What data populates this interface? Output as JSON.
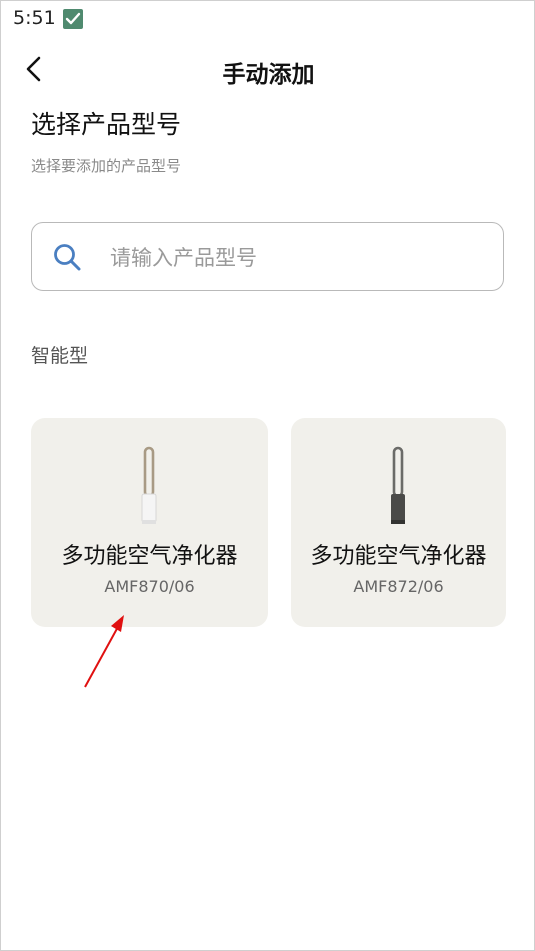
{
  "status_bar": {
    "time": "5:51",
    "app_icon": "checkmark-app-icon",
    "app_icon_color": "#4f8a6f"
  },
  "header": {
    "title": "手动添加",
    "back_icon": "chevron-left-icon"
  },
  "main": {
    "section_title": "选择产品型号",
    "section_subtitle": "选择要添加的产品型号",
    "search": {
      "placeholder": "请输入产品型号",
      "value": "",
      "icon": "search-icon",
      "icon_color": "#4a7fc1"
    },
    "category_label": "智能型",
    "products": [
      {
        "name": "多功能空气净化器",
        "model": "AMF870/06",
        "image": "white-purifier-fan-image",
        "body_color": "#f5f5f5",
        "ring_color": "#a89a84"
      },
      {
        "name": "多功能空气净化器",
        "model": "AMF872/06",
        "image": "dark-purifier-fan-image",
        "body_color": "#4a4a48",
        "ring_color": "#6b6b68"
      }
    ]
  },
  "annotation": {
    "arrow_color": "#e01010"
  }
}
